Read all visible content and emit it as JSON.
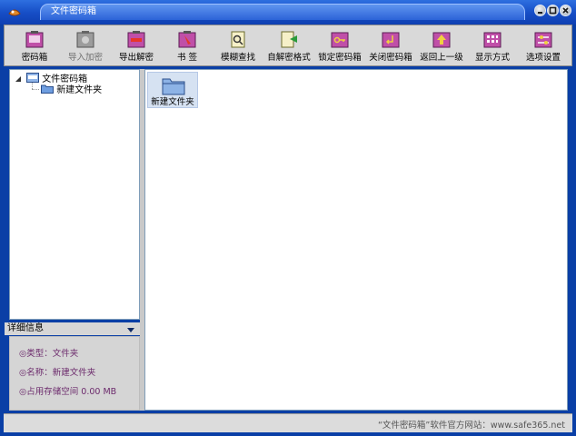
{
  "window": {
    "title": "文件密码箱"
  },
  "toolbar": {
    "items": [
      {
        "label": "密码箱",
        "icon": "password-box-icon",
        "enabled": true
      },
      {
        "label": "导入加密",
        "icon": "import-encrypt-icon",
        "enabled": false
      },
      {
        "label": "导出解密",
        "icon": "export-decrypt-icon",
        "enabled": true
      },
      {
        "label": "书  签",
        "icon": "bookmark-icon",
        "enabled": true
      },
      {
        "label": "模糊查找",
        "icon": "fuzzy-search-icon",
        "enabled": true
      },
      {
        "label": "自解密格式",
        "icon": "self-decrypt-format-icon",
        "enabled": true
      },
      {
        "label": "锁定密码箱",
        "icon": "lock-box-icon",
        "enabled": true
      },
      {
        "label": "关闭密码箱",
        "icon": "close-box-icon",
        "enabled": true
      },
      {
        "label": "返回上一级",
        "icon": "up-level-icon",
        "enabled": true
      },
      {
        "label": "显示方式",
        "icon": "view-mode-icon",
        "enabled": true
      },
      {
        "label": "选项设置",
        "icon": "options-icon",
        "enabled": true
      }
    ]
  },
  "tree": {
    "root": "文件密码箱",
    "children": [
      "新建文件夹"
    ]
  },
  "details": {
    "title": "详细信息",
    "type_line": "◎类型：文件夹",
    "name_line": "◎名称：新建文件夹",
    "size_line": "◎占用存储空间 0.00 MB"
  },
  "content": {
    "items": [
      {
        "label": "新建文件夹",
        "icon": "folder-icon"
      }
    ]
  },
  "status": {
    "text": "“文件密码箱”软件官方网站：www.safe365.net"
  },
  "colors": {
    "frame": "#0a3fa6",
    "title_bar": "#2e6fe0",
    "toolbar": "#d9d9d9",
    "detail_text": "#6c2a6c"
  }
}
